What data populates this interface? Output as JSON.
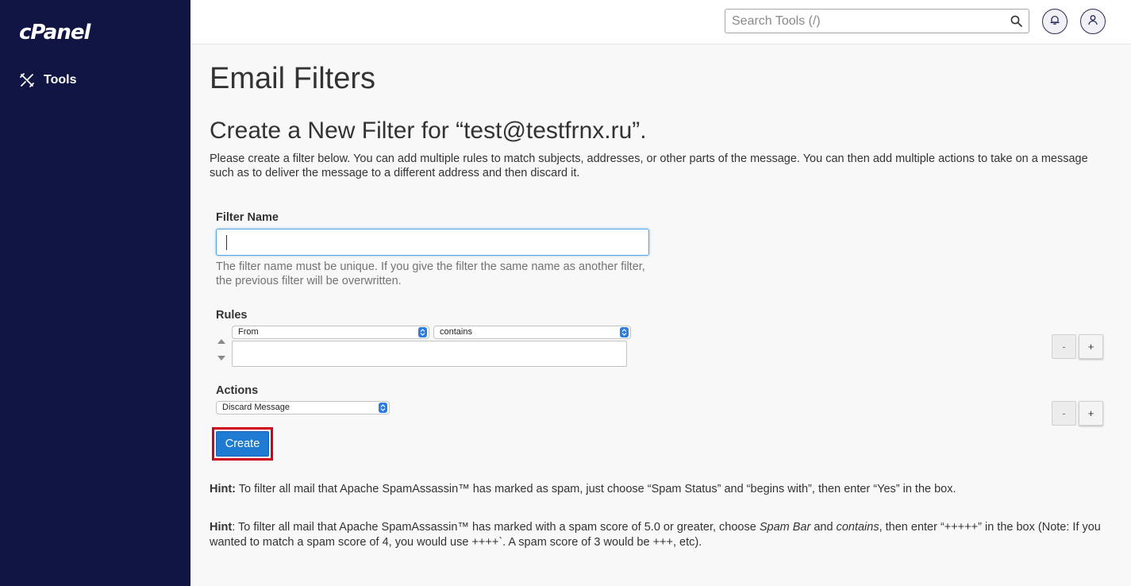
{
  "brand": {
    "logo_text": "cPanel"
  },
  "sidebar": {
    "tools_label": "Tools"
  },
  "topbar": {
    "search_placeholder": "Search Tools (/)"
  },
  "page": {
    "title": "Email Filters",
    "section_title": "Create a New Filter for “test@testfrnx.ru”.",
    "intro": "Please create a filter below. You can add multiple rules to match subjects, addresses, or other parts of the message. You can then add multiple actions to take on a message such as to deliver the message to a different address and then discard it."
  },
  "form": {
    "filter_name_label": "Filter Name",
    "filter_name_value": "",
    "filter_name_help": "The filter name must be unique. If you give the filter the same name as another filter, the previous filter will be overwritten.",
    "rules_label": "Rules",
    "rule_field": "From",
    "rule_operator": "contains",
    "rule_value": "",
    "actions_label": "Actions",
    "action": "Discard Message",
    "minus_label": "-",
    "plus_label": "+",
    "create_label": "Create"
  },
  "hints": {
    "hint1_label": "Hint:",
    "hint1_text": " To filter all mail that Apache SpamAssassin™ has marked as spam, just choose “Spam Status” and “begins with”, then enter “Yes” in the box.",
    "hint2_label": "Hint",
    "hint2_a": ": To filter all mail that Apache SpamAssassin™ has marked with a spam score of 5.0 or greater, choose ",
    "hint2_em1": "Spam Bar",
    "hint2_b": " and ",
    "hint2_em2": "contains",
    "hint2_c": ", then enter “+++++” in the box (Note: If you wanted to match a spam score of 4, you would use ++++`. A spam score of 3 would be +++, etc)."
  },
  "colors": {
    "sidebar_bg": "#101544",
    "primary_button": "#1f7ad2",
    "highlight_border": "#d0011b"
  },
  "icons": [
    "tools-icon",
    "search-icon",
    "bell-icon",
    "user-icon",
    "select-arrows-icon",
    "move-up-icon",
    "move-down-icon"
  ]
}
